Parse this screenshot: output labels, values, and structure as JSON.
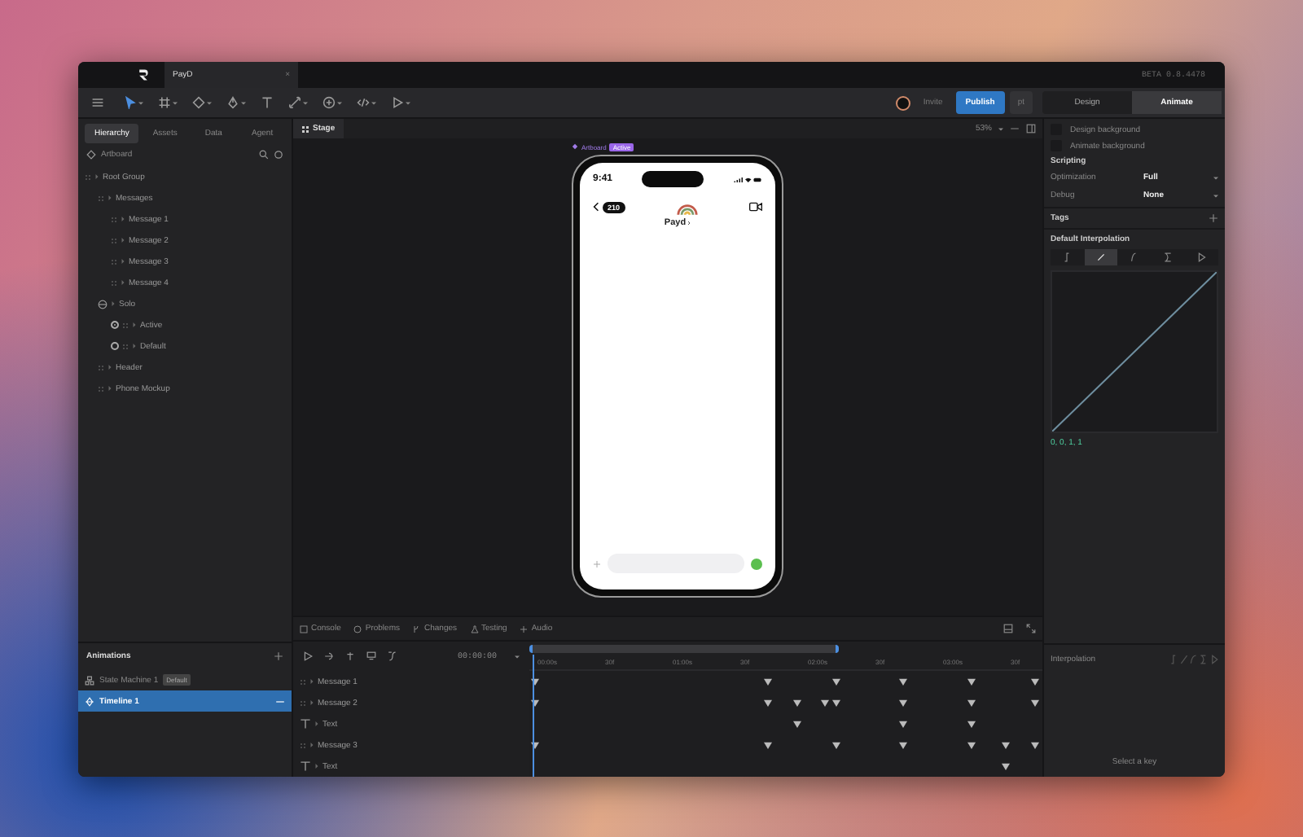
{
  "titlebar": {
    "tab": "PayD",
    "close": "×",
    "version": "BETA 0.8.4478"
  },
  "toolbar": {
    "tools": [
      {
        "kind": "pointer",
        "selected": true,
        "menu": true
      },
      {
        "kind": "frame",
        "selected": false,
        "menu": true
      },
      {
        "kind": "shape",
        "selected": false,
        "menu": true
      },
      {
        "kind": "pen",
        "selected": false,
        "menu": true
      },
      {
        "kind": "text",
        "selected": false,
        "menu": false
      },
      {
        "kind": "bone",
        "selected": false,
        "menu": true
      },
      {
        "kind": "plus",
        "selected": false,
        "menu": true
      },
      {
        "kind": "code",
        "selected": false,
        "menu": true
      },
      {
        "kind": "play",
        "selected": false,
        "menu": true
      }
    ],
    "invite": "Invite",
    "publish": "Publish",
    "share": "pt",
    "modes": [
      {
        "label": "Design",
        "selected": false
      },
      {
        "label": "Animate",
        "selected": true
      }
    ]
  },
  "hierarchy": {
    "tabs": [
      {
        "label": "Hierarchy",
        "selected": true
      },
      {
        "label": "Assets",
        "selected": false
      },
      {
        "label": "Data",
        "selected": false
      },
      {
        "label": "Agent",
        "selected": false
      }
    ],
    "artboard": "Artboard",
    "tree": [
      {
        "kind": "group",
        "name": "Root Group",
        "children": [
          {
            "kind": "group",
            "name": "Messages",
            "children": [
              {
                "kind": "group",
                "name": "Message 1"
              },
              {
                "kind": "group",
                "name": "Message 2"
              },
              {
                "kind": "group",
                "name": "Message 3"
              },
              {
                "kind": "group",
                "name": "Message 4"
              }
            ]
          },
          {
            "kind": "solo",
            "name": "Solo",
            "children": [
              {
                "kind": "option",
                "name": "Active",
                "selected": true
              },
              {
                "kind": "option",
                "name": "Default",
                "selected": false
              }
            ]
          },
          {
            "kind": "group",
            "name": "Header"
          },
          {
            "kind": "group",
            "name": "Phone Mockup"
          }
        ]
      }
    ]
  },
  "animations": {
    "title": "Animations",
    "items": [
      {
        "kind": "state_machine",
        "name": "State Machine 1",
        "badge": "Default",
        "selected": false
      },
      {
        "kind": "timeline",
        "name": "Timeline 1",
        "selected": true
      }
    ]
  },
  "stage": {
    "tab": "Stage",
    "zoom": "53%",
    "artboard": "Artboard",
    "badge": "Active",
    "phone": {
      "time": "9:41",
      "count": "210",
      "contact": "Payd"
    }
  },
  "bottom_tabs": [
    {
      "kind": "console",
      "label": "Console"
    },
    {
      "kind": "problems",
      "label": "Problems"
    },
    {
      "kind": "changes",
      "label": "Changes"
    },
    {
      "kind": "testing",
      "label": "Testing"
    },
    {
      "kind": "audio",
      "label": "Audio"
    }
  ],
  "timeline": {
    "time": "00:00:00",
    "ruler": [
      "00:00s",
      "30f",
      "01:00s",
      "30f",
      "02:00s",
      "30f",
      "03:00s",
      "30f"
    ],
    "rows": [
      {
        "kind": "group",
        "name": "Message 1",
        "keys": [
          {
            "level": 0.01
          },
          {
            "level": 0.466
          },
          {
            "level": 0.598
          },
          {
            "level": 0.73
          },
          {
            "level": 0.861
          },
          {
            "level": 0.985
          }
        ]
      },
      {
        "kind": "group",
        "name": "Message 2",
        "keys": [
          {
            "level": 0.01
          },
          {
            "level": 0.466
          },
          {
            "level": 0.523
          },
          {
            "level": 0.576
          },
          {
            "level": 0.598
          },
          {
            "level": 0.73
          },
          {
            "level": 0.861
          },
          {
            "level": 0.985
          }
        ]
      },
      {
        "kind": "text",
        "name": "Text",
        "keys": [
          {
            "level": 0.523
          },
          {
            "level": 0.73
          },
          {
            "level": 0.861
          }
        ]
      },
      {
        "kind": "group",
        "name": "Message 3",
        "keys": [
          {
            "level": 0.01
          },
          {
            "level": 0.466
          },
          {
            "level": 0.598
          },
          {
            "level": 0.73
          },
          {
            "level": 0.861
          },
          {
            "level": 0.927
          },
          {
            "level": 0.985
          }
        ]
      },
      {
        "kind": "text",
        "name": "Text",
        "keys": [
          {
            "level": 0.927
          }
        ]
      }
    ]
  },
  "inspector": {
    "checks": [
      {
        "label": "Design background",
        "checked": false
      },
      {
        "label": "Animate background",
        "checked": false
      }
    ],
    "scripting": "Scripting",
    "fields": [
      {
        "label": "Optimization",
        "value": "Full"
      },
      {
        "label": "Debug",
        "value": "None"
      }
    ],
    "tags": "Tags",
    "interpolation_title": "Default Interpolation",
    "curves": [
      {
        "kind": "hold",
        "selected": false
      },
      {
        "kind": "linear",
        "selected": true
      },
      {
        "kind": "cubic",
        "selected": false
      },
      {
        "kind": "elastic",
        "selected": false
      },
      {
        "kind": "custom",
        "selected": false
      }
    ],
    "curve_value": "0, 0, 1, 1"
  },
  "key_panel": {
    "title": "Interpolation",
    "hint": "Select a key"
  }
}
